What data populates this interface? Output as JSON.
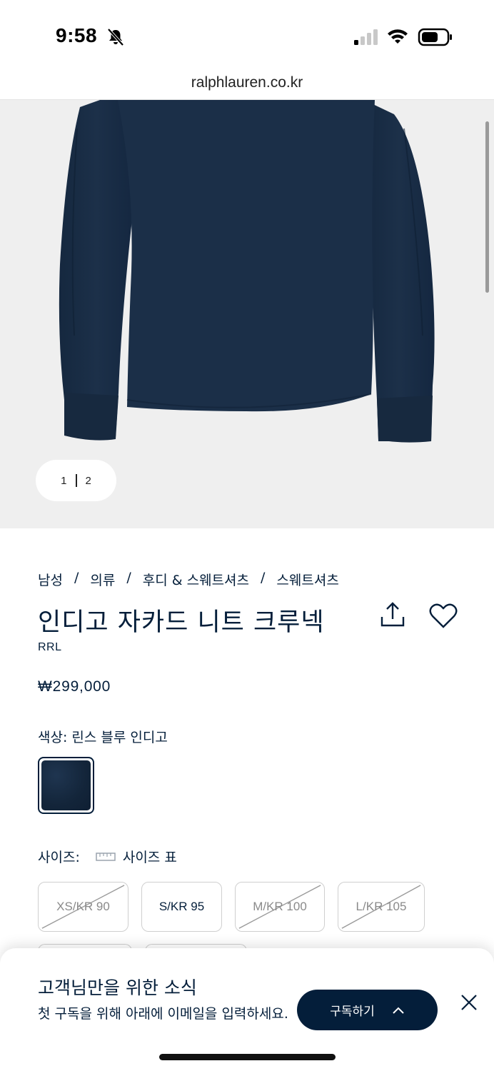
{
  "status_bar": {
    "time": "9:58",
    "icons": [
      "bell-slash-icon",
      "cellular-signal-icon",
      "wifi-icon",
      "battery-icon"
    ]
  },
  "browser": {
    "url": "ralphlauren.co.kr"
  },
  "gallery": {
    "current": "1",
    "total": "2"
  },
  "breadcrumb": [
    "남성",
    "의류",
    "후디 & 스웨트셔츠",
    "스웨트셔츠"
  ],
  "product": {
    "title": "인디고 자카드 니트 크루넥",
    "brand": "RRL",
    "price": "₩299,000",
    "color_label": "색상: 린스 블루 인디고",
    "swatch_color": "#13253a"
  },
  "size": {
    "label": "사이즈:",
    "chart_link": "사이즈 표",
    "options": [
      {
        "label": "XS/KR 90",
        "available": false
      },
      {
        "label": "S/KR 95",
        "available": true
      },
      {
        "label": "M/KR 100",
        "available": false
      },
      {
        "label": "L/KR 105",
        "available": false
      }
    ]
  },
  "newsletter": {
    "title": "고객님만을 위한 소식",
    "body": "첫 구독을 위해 아래에 이메일을 입력하세요.",
    "button_label": "구독하기"
  },
  "colors": {
    "navy": "#041e3a",
    "sweater": "#1a2d45",
    "background": "#efefef"
  }
}
